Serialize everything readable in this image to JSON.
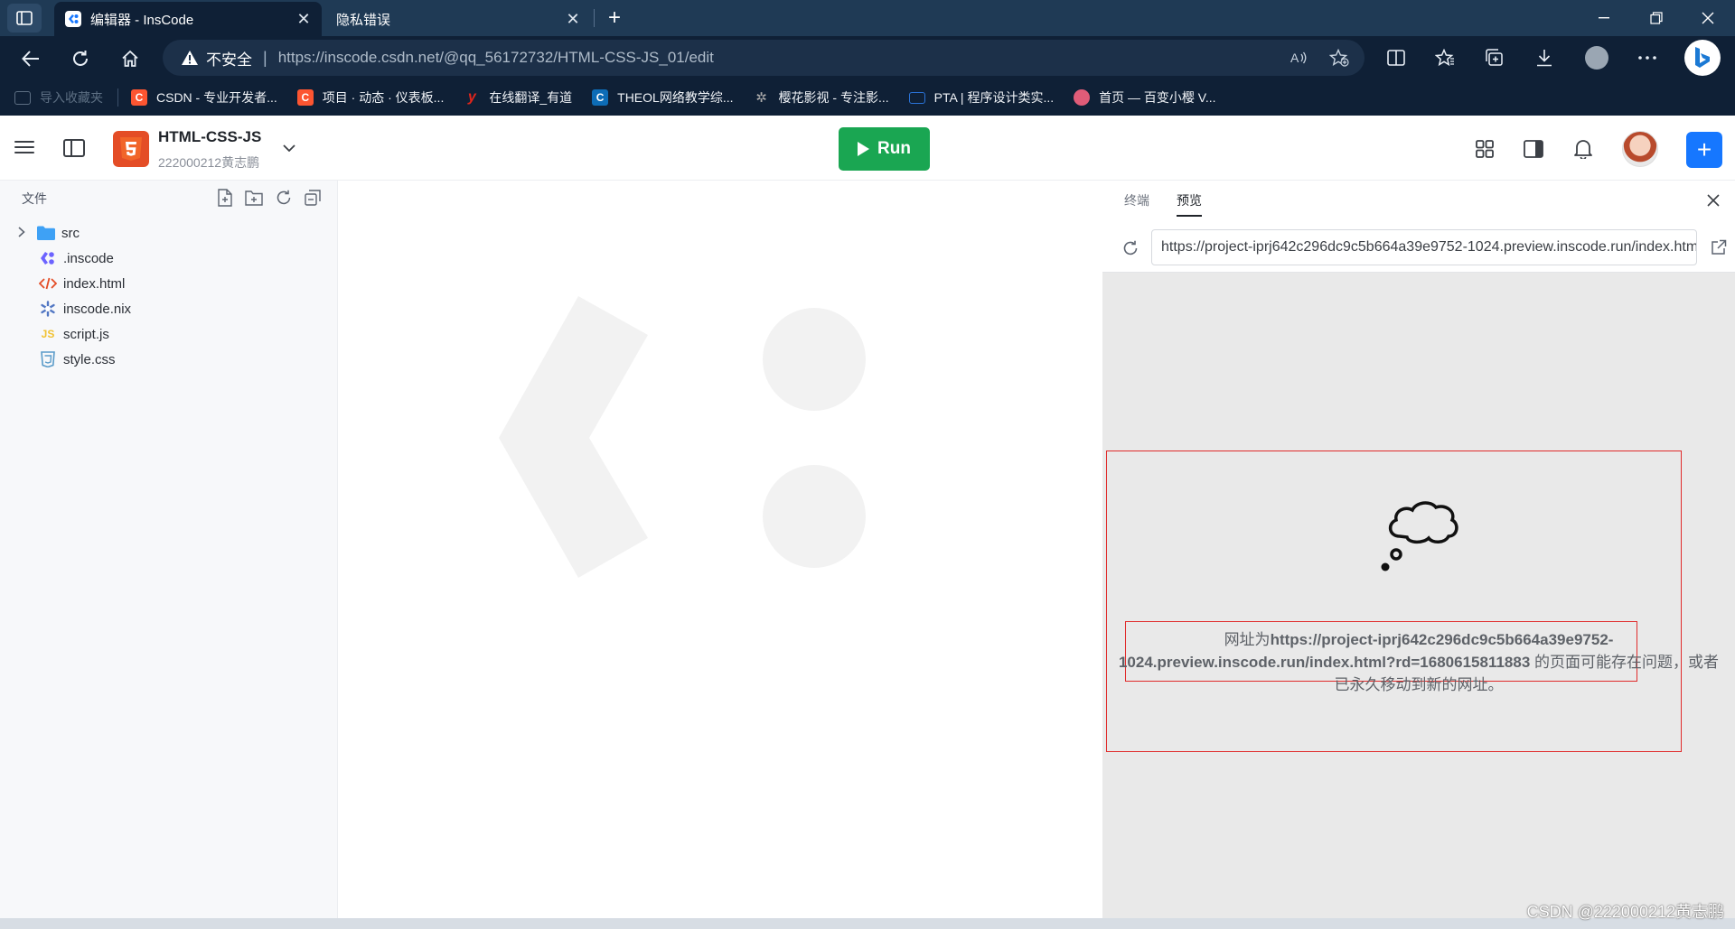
{
  "browser": {
    "tabs": [
      {
        "title": "编辑器 - InsCode",
        "active": true
      },
      {
        "title": "隐私错误",
        "active": false
      }
    ],
    "security_label": "不安全",
    "url_host": "https://inscode.csdn.net",
    "url_path": "/@qq_56172732/HTML-CSS-JS_01/edit",
    "bookmarks": [
      {
        "label": "导入收藏夹",
        "color": "#5d6f83"
      },
      {
        "label": "CSDN - 专业开发者...",
        "color": "#fc5531",
        "glyph": "C"
      },
      {
        "label": "项目 · 动态 · 仪表板...",
        "color": "#fc5531",
        "glyph": "C"
      },
      {
        "label": "在线翻译_有道",
        "color": "#e1251b",
        "glyph": "y"
      },
      {
        "label": "THEOL网络教学综...",
        "color": "#0d6cb6",
        "glyph": "C"
      },
      {
        "label": "樱花影视 - 专注影...",
        "color": "#333333",
        "glyph": "✲"
      },
      {
        "label": "PTA | 程序设计类实...",
        "color": "#2a73d8",
        "glyph": "▭"
      },
      {
        "label": "首页 — 百变小樱 V...",
        "color": "#e05c78",
        "glyph": "●"
      }
    ]
  },
  "app": {
    "project_name": "HTML-CSS-JS",
    "project_owner": "222000212黄志鹏",
    "run_label": "Run",
    "sidebar": {
      "title": "文件",
      "files": [
        {
          "name": "src",
          "type": "folder",
          "icon": "folder-icon",
          "color": "#3ea1f5"
        },
        {
          "name": ".inscode",
          "type": "file",
          "icon": "inscode-icon",
          "color": "#6c63ff"
        },
        {
          "name": "index.html",
          "type": "file",
          "icon": "html-icon",
          "color": "#e44d26"
        },
        {
          "name": "inscode.nix",
          "type": "file",
          "icon": "nix-icon",
          "color": "#5277c3"
        },
        {
          "name": "script.js",
          "type": "file",
          "icon": "js-icon",
          "color": "#f1c232"
        },
        {
          "name": "style.css",
          "type": "file",
          "icon": "css-icon",
          "color": "#5a9bc9"
        }
      ]
    },
    "right_panel": {
      "tabs": [
        "终端",
        "预览"
      ],
      "active_tab": "预览",
      "preview_url": "https://project-iprj642c296dc9c5b664a39e9752-1024.preview.inscode.run/index.html?rd=1680615811883",
      "error": {
        "prefix": "网址为",
        "url": "https://project-iprj642c296dc9c5b664a39e9752-1024.preview.inscode.run/index.html?rd=1680615811883",
        "suffix": " 的页面可能存在问题，或者已永久移动到新的网址。"
      }
    }
  },
  "watermark": "CSDN @222000212黄志鹏"
}
